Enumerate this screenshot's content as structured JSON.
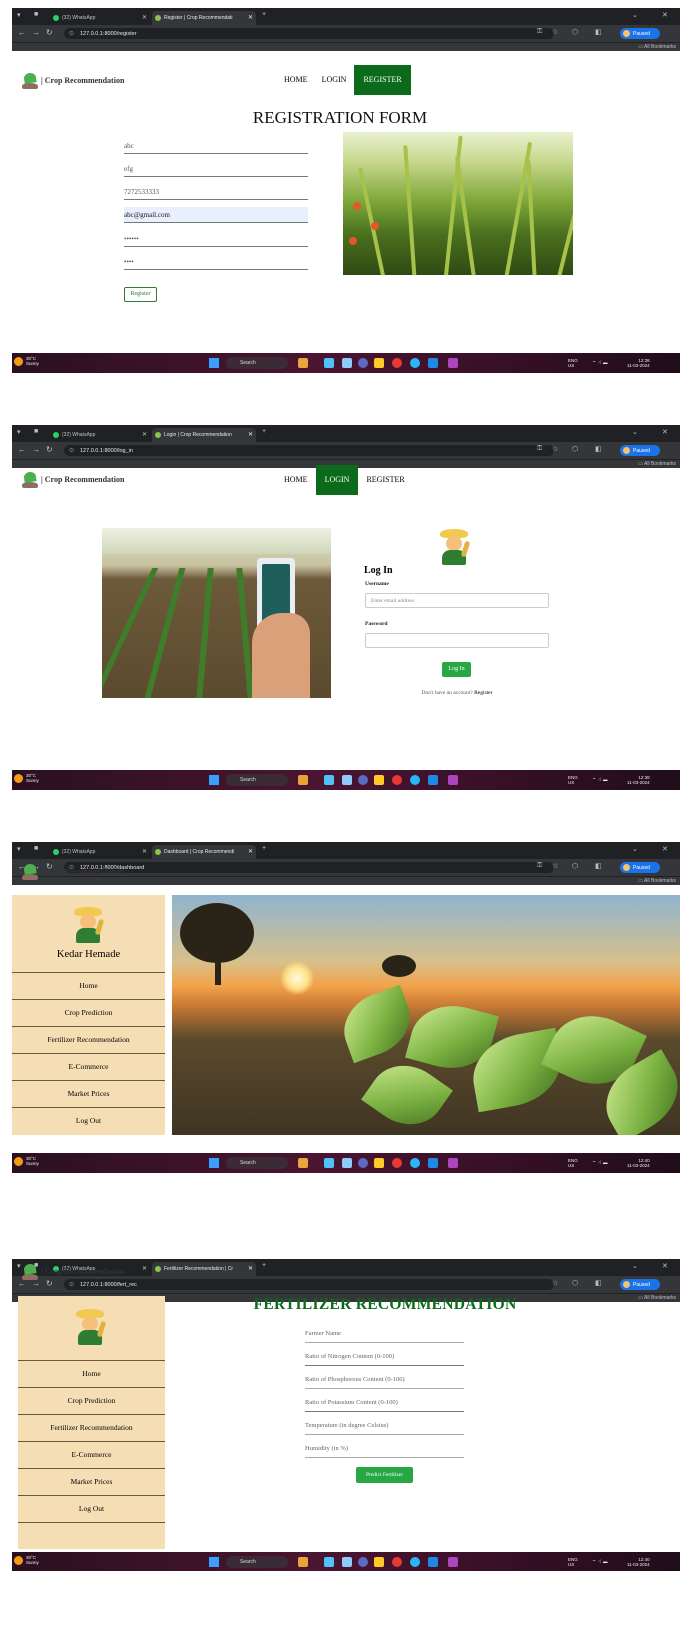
{
  "browser": {
    "tab1_label": "(32) WhatsApp",
    "omni_prefix": "",
    "paused_label": "Paused",
    "all_bookmarks": "All Bookmarks"
  },
  "screens": [
    {
      "active_tab": "Register | Crop Recommendati",
      "url": "127.0.0.1:8000/register"
    },
    {
      "active_tab": "Login | Crop Recommendation",
      "url": "127.0.0.1:8000/log_in"
    },
    {
      "active_tab": "Dashboard | Crop Recommendi",
      "url": "127.0.0.1:8000/dashboard"
    },
    {
      "active_tab": "Fertilizer Recommendation | Cr",
      "url": "127.0.0.1:8000/fert_rec"
    }
  ],
  "taskbar": {
    "weather_temp": "30°C",
    "weather_desc": "Sunny",
    "search": "Search",
    "lang": "ENG",
    "region": "US",
    "times": [
      "12:38",
      "12:38",
      "12:40",
      "12:40"
    ],
    "date": "11-03-2024"
  },
  "site": {
    "brand": "| Crop Recommendation",
    "nav": {
      "home": "HOME",
      "login": "LOGIN",
      "register": "REGISTER"
    }
  },
  "register": {
    "title": "REGISTRATION FORM",
    "fields": [
      "abc",
      "efg",
      "7272533333",
      "abc@gmail.com",
      "••••••",
      "••••"
    ],
    "button": "Register"
  },
  "login": {
    "heading": "Log In",
    "username_label": "Username",
    "username_placeholder": "Enter email address",
    "password_label": "Password",
    "button": "Log In",
    "signup_text": "Don't have an account?",
    "signup_link": "Register"
  },
  "dashboard": {
    "user_name": "Kedar Hemade",
    "menu": [
      "Home",
      "Crop Prediction",
      "Fertilizer Recommendation",
      "E-Commerce",
      "Market Prices",
      "Log Out"
    ]
  },
  "fertilizer": {
    "title": "FERTILIZER RECOMMENDATION",
    "fields": [
      "Farmer Name",
      "Ratio of Nitrogen Content (0-100)",
      "Ratio of Phosphorous Content (0-100)",
      "Ratio of Potassium Content (0-100)",
      "Temperature (in degree Celsius)",
      "Humidity (in %)"
    ],
    "button": "Predict Fertilizer"
  }
}
